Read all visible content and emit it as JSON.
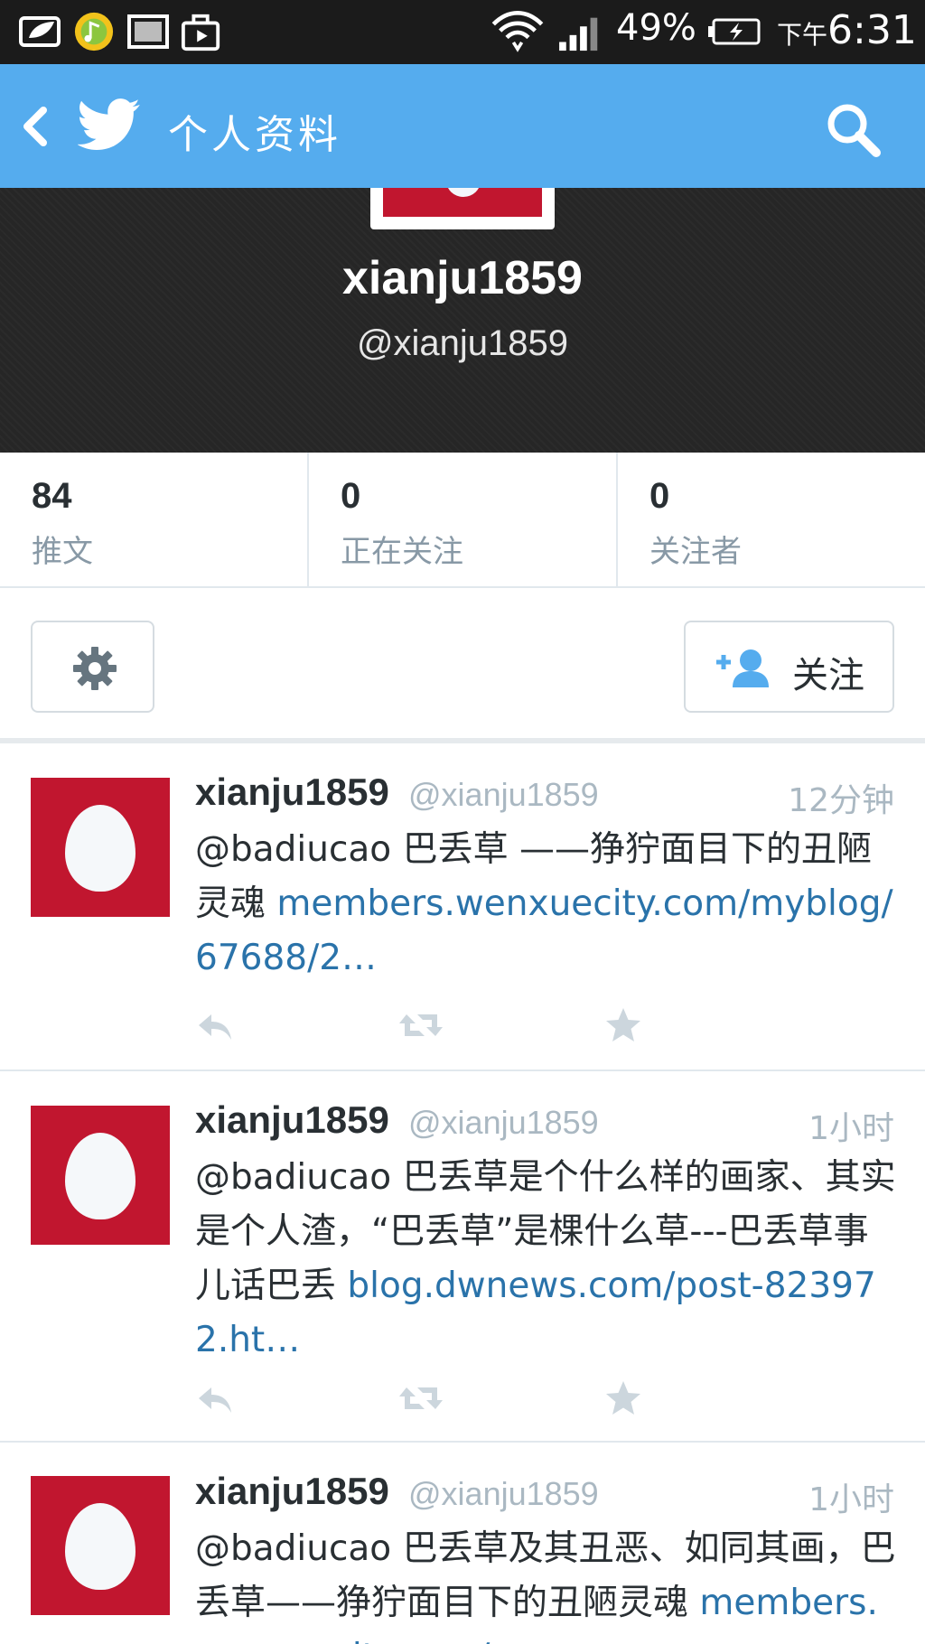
{
  "status_bar": {
    "battery_percent": "49%",
    "time_prefix": "下午",
    "time": "6:31",
    "icons": [
      "leaf-app-icon",
      "music-app-icon",
      "picture-app-icon",
      "store-app-icon",
      "wifi-icon",
      "signal-icon",
      "battery-icon"
    ]
  },
  "app_bar": {
    "title": "个人资料",
    "icons": [
      "back-icon",
      "twitter-bird-icon",
      "search-icon"
    ],
    "background": "#55acee"
  },
  "profile": {
    "name": "xianju1859",
    "handle": "@xianju1859"
  },
  "stats": [
    {
      "count": "84",
      "label": "推文"
    },
    {
      "count": "0",
      "label": "正在关注"
    },
    {
      "count": "0",
      "label": "关注者"
    }
  ],
  "actions": {
    "settings_icon": "gear-icon",
    "follow_label": "关注",
    "follow_icon": "add-user-icon"
  },
  "tweets": [
    {
      "name": "xianju1859",
      "handle": "@xianju1859",
      "time": "12分钟",
      "text": "@badiucao 巴丢草 ——狰狞面目下的丑陋灵魂 ",
      "link": "members.wenxuecity.com/myblog/67688/2…"
    },
    {
      "name": "xianju1859",
      "handle": "@xianju1859",
      "time": "1小时",
      "text": "@badiucao 巴丢草是个什么样的画家、其实是个人渣，“巴丢草”是棵什么草---巴丢草事儿话巴丢 ",
      "link": "blog.dwnews.com/post-823972.ht…"
    },
    {
      "name": "xianju1859",
      "handle": "@xianju1859",
      "time": "1小时",
      "text": "@badiucao 巴丢草及其丑恶、如同其画，巴丢草——狰狞面目下的丑陋灵魂 ",
      "link": "members.wenxuecity.com/"
    }
  ],
  "colors": {
    "accent": "#55acee",
    "link": "#2a73aa",
    "avatar_red": "#c1162f"
  }
}
